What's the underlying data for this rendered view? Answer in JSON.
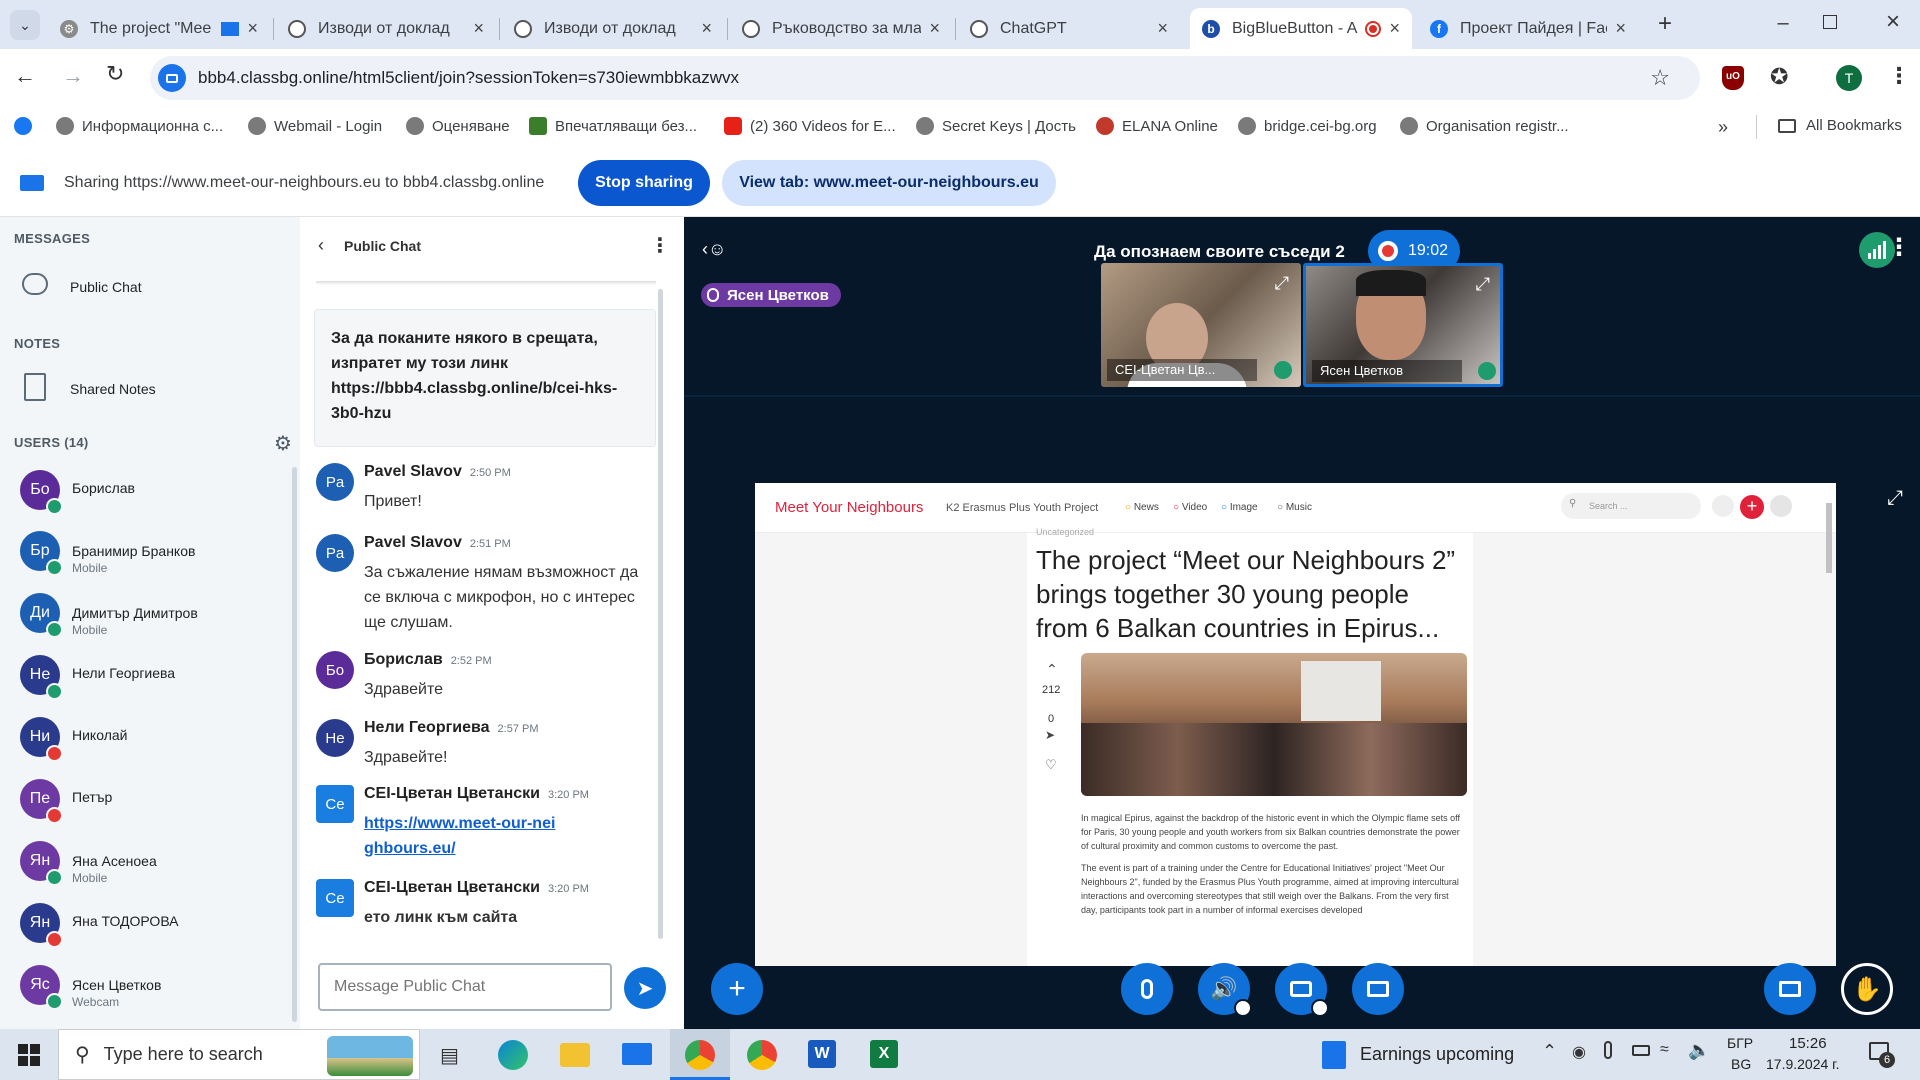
{
  "browser": {
    "tabs": [
      {
        "title": "The project \"Mee",
        "icon": "settings-icon"
      },
      {
        "title": "Изводи от доклад",
        "icon": "openai-icon"
      },
      {
        "title": "Изводи от доклад",
        "icon": "openai-icon"
      },
      {
        "title": "Ръководство за мла",
        "icon": "openai-icon"
      },
      {
        "title": "ChatGPT",
        "icon": "openai-icon"
      },
      {
        "title": "BigBlueButton - A",
        "icon": "bigbluebutton-icon"
      },
      {
        "title": "Проект Пайдея | Fac",
        "icon": "facebook-icon"
      }
    ],
    "url": "bbb4.classbg.online/html5client/join?sessionToken=s730iewmbbkazwvx",
    "bookmarks": [
      {
        "label": "Информационна с...",
        "color": "#7a7a7a"
      },
      {
        "label": "Webmail - Login",
        "color": "#7a7a7a"
      },
      {
        "label": "Оценяване",
        "color": "#7a7a7a"
      },
      {
        "label": "Впечатляващи без...",
        "color": "#3b7d2a"
      },
      {
        "label": "(2) 360 Videos for E...",
        "color": "#e62117"
      },
      {
        "label": "Secret Keys | Дость",
        "color": "#7a7a7a"
      },
      {
        "label": "ELANA Online",
        "color": "#c0392b"
      },
      {
        "label": "bridge.cei-bg.org",
        "color": "#7a7a7a"
      },
      {
        "label": "Organisation registr...",
        "color": "#7a7a7a"
      }
    ],
    "all_bookmarks": "All Bookmarks",
    "profile_initial": "T",
    "sharing": {
      "text": "Sharing https://www.meet-our-neighbours.eu to bbb4.classbg.online",
      "stop": "Stop sharing",
      "view_tab": "View tab: www.meet-our-neighbours.eu"
    }
  },
  "sidebar": {
    "messages_heading": "MESSAGES",
    "public_chat": "Public Chat",
    "notes_heading": "NOTES",
    "shared_notes": "Shared Notes",
    "users_heading": "USERS (14)",
    "users": [
      {
        "initials": "Бо",
        "name": "Борислав",
        "sub": "",
        "color": "#5b2c99",
        "badge": "#1f9c6e"
      },
      {
        "initials": "Бр",
        "name": "Бранимир Бранков",
        "sub": "Mobile",
        "color": "#1d5fb3",
        "badge": "#1f9c6e"
      },
      {
        "initials": "Ди",
        "name": "Димитър Димитров",
        "sub": "Mobile",
        "color": "#1d5fb3",
        "badge": "#1f9c6e"
      },
      {
        "initials": "Не",
        "name": "Нели Георгиева",
        "sub": "",
        "color": "#2a3a8c",
        "badge": "#1f9c6e"
      },
      {
        "initials": "Ни",
        "name": "Николай",
        "sub": "",
        "color": "#2a3a8c",
        "badge": "#e53935"
      },
      {
        "initials": "Пе",
        "name": "Петър",
        "sub": "",
        "color": "#6d3aa3",
        "badge": "#e53935"
      },
      {
        "initials": "Ян",
        "name": "Яна Асеноеа",
        "sub": "Mobile",
        "color": "#6d3aa3",
        "badge": "#1f9c6e"
      },
      {
        "initials": "Ян",
        "name": "Яна ТОДОРОВА",
        "sub": "",
        "color": "#2a3a8c",
        "badge": "#e53935"
      },
      {
        "initials": "Яс",
        "name": "Ясен Цветков",
        "sub": "Webcam",
        "color": "#6d3aa3",
        "badge": "#1f9c6e"
      }
    ]
  },
  "chat": {
    "title": "Public Chat",
    "welcome": "За да поканите някого в срещата, изпратет му този линк https://bbb4.classbg.online/b/cei-hks-3b0-hzu",
    "messages": [
      {
        "initials": "Pa",
        "name": "Pavel Slavov",
        "time": "2:50 PM",
        "text": "Привет!",
        "color": "#1d5fb3",
        "link": false
      },
      {
        "initials": "Pa",
        "name": "Pavel Slavov",
        "time": "2:51 PM",
        "text": "За съжаление нямам възможност да се включа с микрофон, но с интерес ще слушам.",
        "color": "#1d5fb3",
        "link": false
      },
      {
        "initials": "Бо",
        "name": "Борислав",
        "time": "2:52 PM",
        "text": "Здравейте",
        "color": "#5b2c99",
        "link": false
      },
      {
        "initials": "Не",
        "name": "Нели Георгиева",
        "time": "2:57 PM",
        "text": "Здравейте!",
        "color": "#2a3a8c",
        "link": false
      },
      {
        "initials": "Ce",
        "name": "CEI-Цветан Цветански",
        "time": "3:20 PM",
        "text": "https://www.meet-our-neighbours.eu/",
        "color": "#1a7de0",
        "link": true
      },
      {
        "initials": "Ce",
        "name": "CEI-Цветан Цветански",
        "time": "3:20 PM",
        "text": "ето линк към сайта",
        "color": "#1a7de0",
        "link": false
      }
    ],
    "input_placeholder": "Message Public Chat"
  },
  "meeting": {
    "title": "Да опознаем своите съседи 2",
    "timer": "19:02",
    "talker": "Ясен Цветков",
    "videos": [
      {
        "name": "CEI-Цветан Цв..."
      },
      {
        "name": "Ясен Цветков"
      }
    ]
  },
  "website": {
    "brand": "Meet Your Neighbours",
    "subtitle": "K2 Erasmus Plus Youth Project",
    "nav": [
      "News",
      "Video",
      "Image",
      "Music"
    ],
    "search_placeholder": "Search ...",
    "category": "Uncategorized",
    "headline": "The project “Meet our Neighbours 2” brings together 30 young people from 6 Balkan countries in Epirus...",
    "votes": "212",
    "comments": "0",
    "para1": "In magical Epirus, against the backdrop of the historic event in which the Olympic flame sets off for Paris, 30 young people and youth workers from six Balkan countries demonstrate the power of cultural proximity and common customs to overcome the past.",
    "para2": "The event is part of a training under the Centre for Educational Initiatives' project \"Meet Our Neighbours 2\", funded by the Erasmus Plus Youth programme, aimed at improving intercultural interactions and overcoming stereotypes that still weigh over the Balkans. From the very first day, participants took part in a number of informal exercises developed"
  },
  "taskbar": {
    "search_placeholder": "Type here to search",
    "widget": "Earnings upcoming",
    "lang_top": "БГР",
    "lang_bottom": "BG",
    "time": "15:26",
    "date": "17.9.2024 г.",
    "notifications": "6"
  }
}
